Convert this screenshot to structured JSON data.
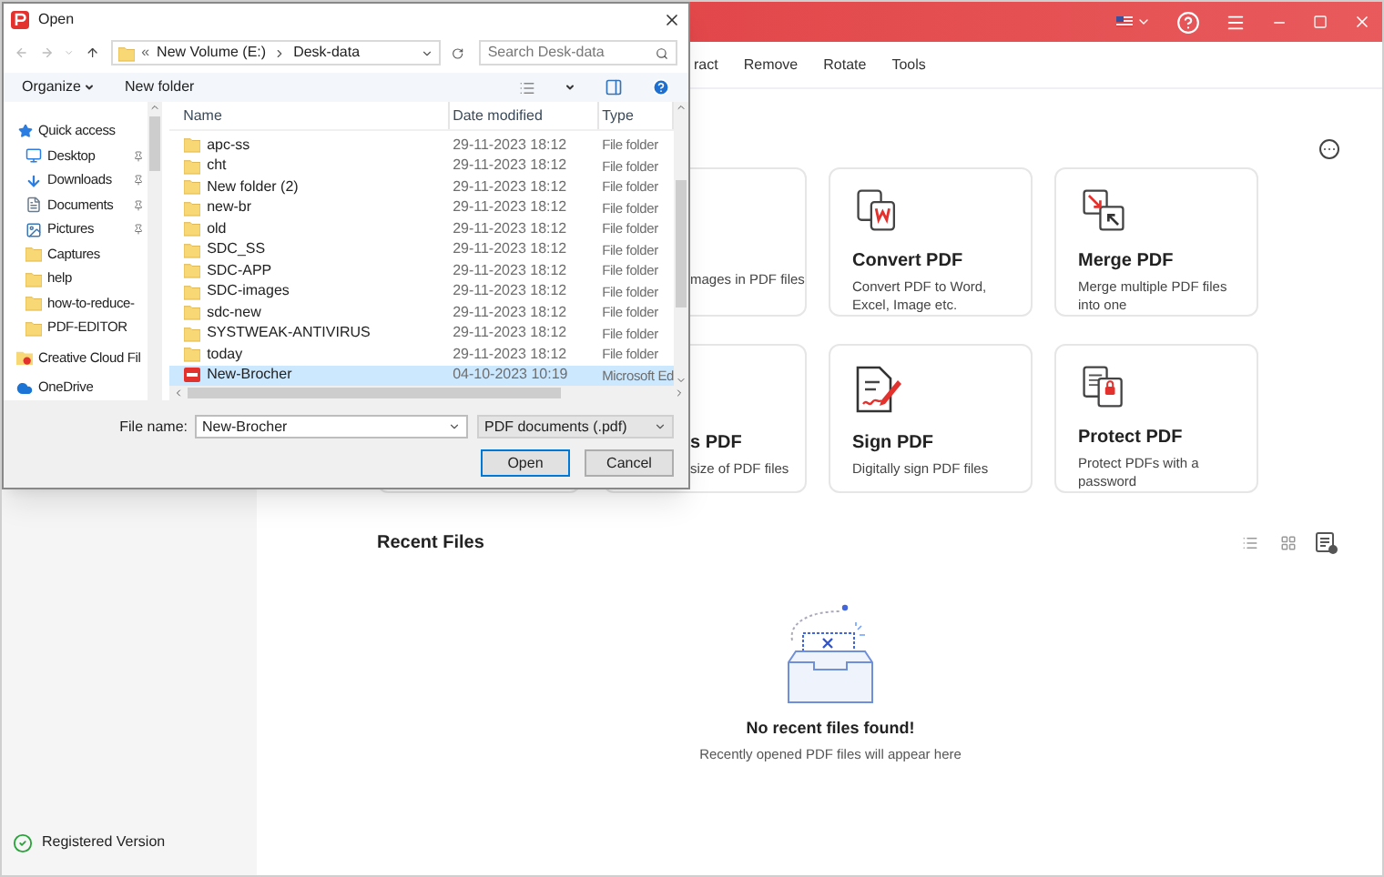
{
  "app": {
    "menu": [
      "ract",
      "Remove",
      "Rotate",
      "Tools"
    ],
    "cards": [
      {
        "kind": "partial",
        "description": "mages in PDF files"
      },
      {
        "kind": "convert",
        "title": "Convert PDF",
        "description": "Convert PDF to Word, Excel, Image etc."
      },
      {
        "kind": "merge",
        "title": "Merge PDF",
        "description": "Merge multiple PDF files into one"
      },
      {
        "kind": "partial",
        "title": "s PDF",
        "description": "size of PDF files"
      },
      {
        "kind": "sign",
        "title": "Sign PDF",
        "description": "Digitally sign PDF files"
      },
      {
        "kind": "protect",
        "title": "Protect PDF",
        "description": "Protect PDFs with a password"
      }
    ],
    "recent": {
      "title": "Recent Files",
      "empty_title": "No recent files found!",
      "empty_text": "Recently opened PDF files will appear here"
    },
    "status": "Registered Version"
  },
  "dialog": {
    "title": "Open",
    "address": {
      "prefix": "«",
      "segments": [
        "New Volume (E:)",
        "Desk-data"
      ]
    },
    "search": {
      "placeholder": "Search Desk-data"
    },
    "toolbar": [
      "Organize",
      "New folder"
    ],
    "nav": [
      {
        "label": "Quick access",
        "kind": "star",
        "pinned": false
      },
      {
        "label": "Desktop",
        "kind": "desktop",
        "pinned": true
      },
      {
        "label": "Downloads",
        "kind": "download",
        "pinned": true
      },
      {
        "label": "Documents",
        "kind": "documents",
        "pinned": true
      },
      {
        "label": "Pictures",
        "kind": "pictures",
        "pinned": true
      },
      {
        "label": "Captures",
        "kind": "folder",
        "pinned": false
      },
      {
        "label": "help",
        "kind": "folder",
        "pinned": false
      },
      {
        "label": "how-to-reduce-",
        "kind": "folder",
        "pinned": false
      },
      {
        "label": "PDF-EDITOR",
        "kind": "folder",
        "pinned": false
      },
      {
        "label": "Creative Cloud Fil",
        "kind": "creative",
        "pinned": false
      },
      {
        "label": "OneDrive",
        "kind": "cloud",
        "pinned": false
      }
    ],
    "columns": [
      "Name",
      "Date modified",
      "Type"
    ],
    "files": [
      {
        "name": "apc-ss",
        "date": "29-11-2023 18:12",
        "type": "File folder",
        "kind": "folder",
        "selected": false
      },
      {
        "name": "cht",
        "date": "29-11-2023 18:12",
        "type": "File folder",
        "kind": "folder",
        "selected": false
      },
      {
        "name": "New folder (2)",
        "date": "29-11-2023 18:12",
        "type": "File folder",
        "kind": "folder",
        "selected": false
      },
      {
        "name": "new-br",
        "date": "29-11-2023 18:12",
        "type": "File folder",
        "kind": "folder",
        "selected": false
      },
      {
        "name": "old",
        "date": "29-11-2023 18:12",
        "type": "File folder",
        "kind": "folder",
        "selected": false
      },
      {
        "name": "SDC_SS",
        "date": "29-11-2023 18:12",
        "type": "File folder",
        "kind": "folder",
        "selected": false
      },
      {
        "name": "SDC-APP",
        "date": "29-11-2023 18:12",
        "type": "File folder",
        "kind": "folder",
        "selected": false
      },
      {
        "name": "SDC-images",
        "date": "29-11-2023 18:12",
        "type": "File folder",
        "kind": "folder",
        "selected": false
      },
      {
        "name": "sdc-new",
        "date": "29-11-2023 18:12",
        "type": "File folder",
        "kind": "folder",
        "selected": false
      },
      {
        "name": "SYSTWEAK-ANTIVIRUS",
        "date": "29-11-2023 18:12",
        "type": "File folder",
        "kind": "folder",
        "selected": false
      },
      {
        "name": "today",
        "date": "29-11-2023 18:12",
        "type": "File folder",
        "kind": "folder",
        "selected": false
      },
      {
        "name": "New-Brocher",
        "date": "04-10-2023 10:19",
        "type": "Microsoft Ed",
        "kind": "pdf",
        "selected": true
      }
    ],
    "file_name_label": "File name:",
    "file_name": "New-Brocher",
    "file_type": "PDF documents (.pdf)",
    "buttons": [
      "Open",
      "Cancel"
    ]
  }
}
